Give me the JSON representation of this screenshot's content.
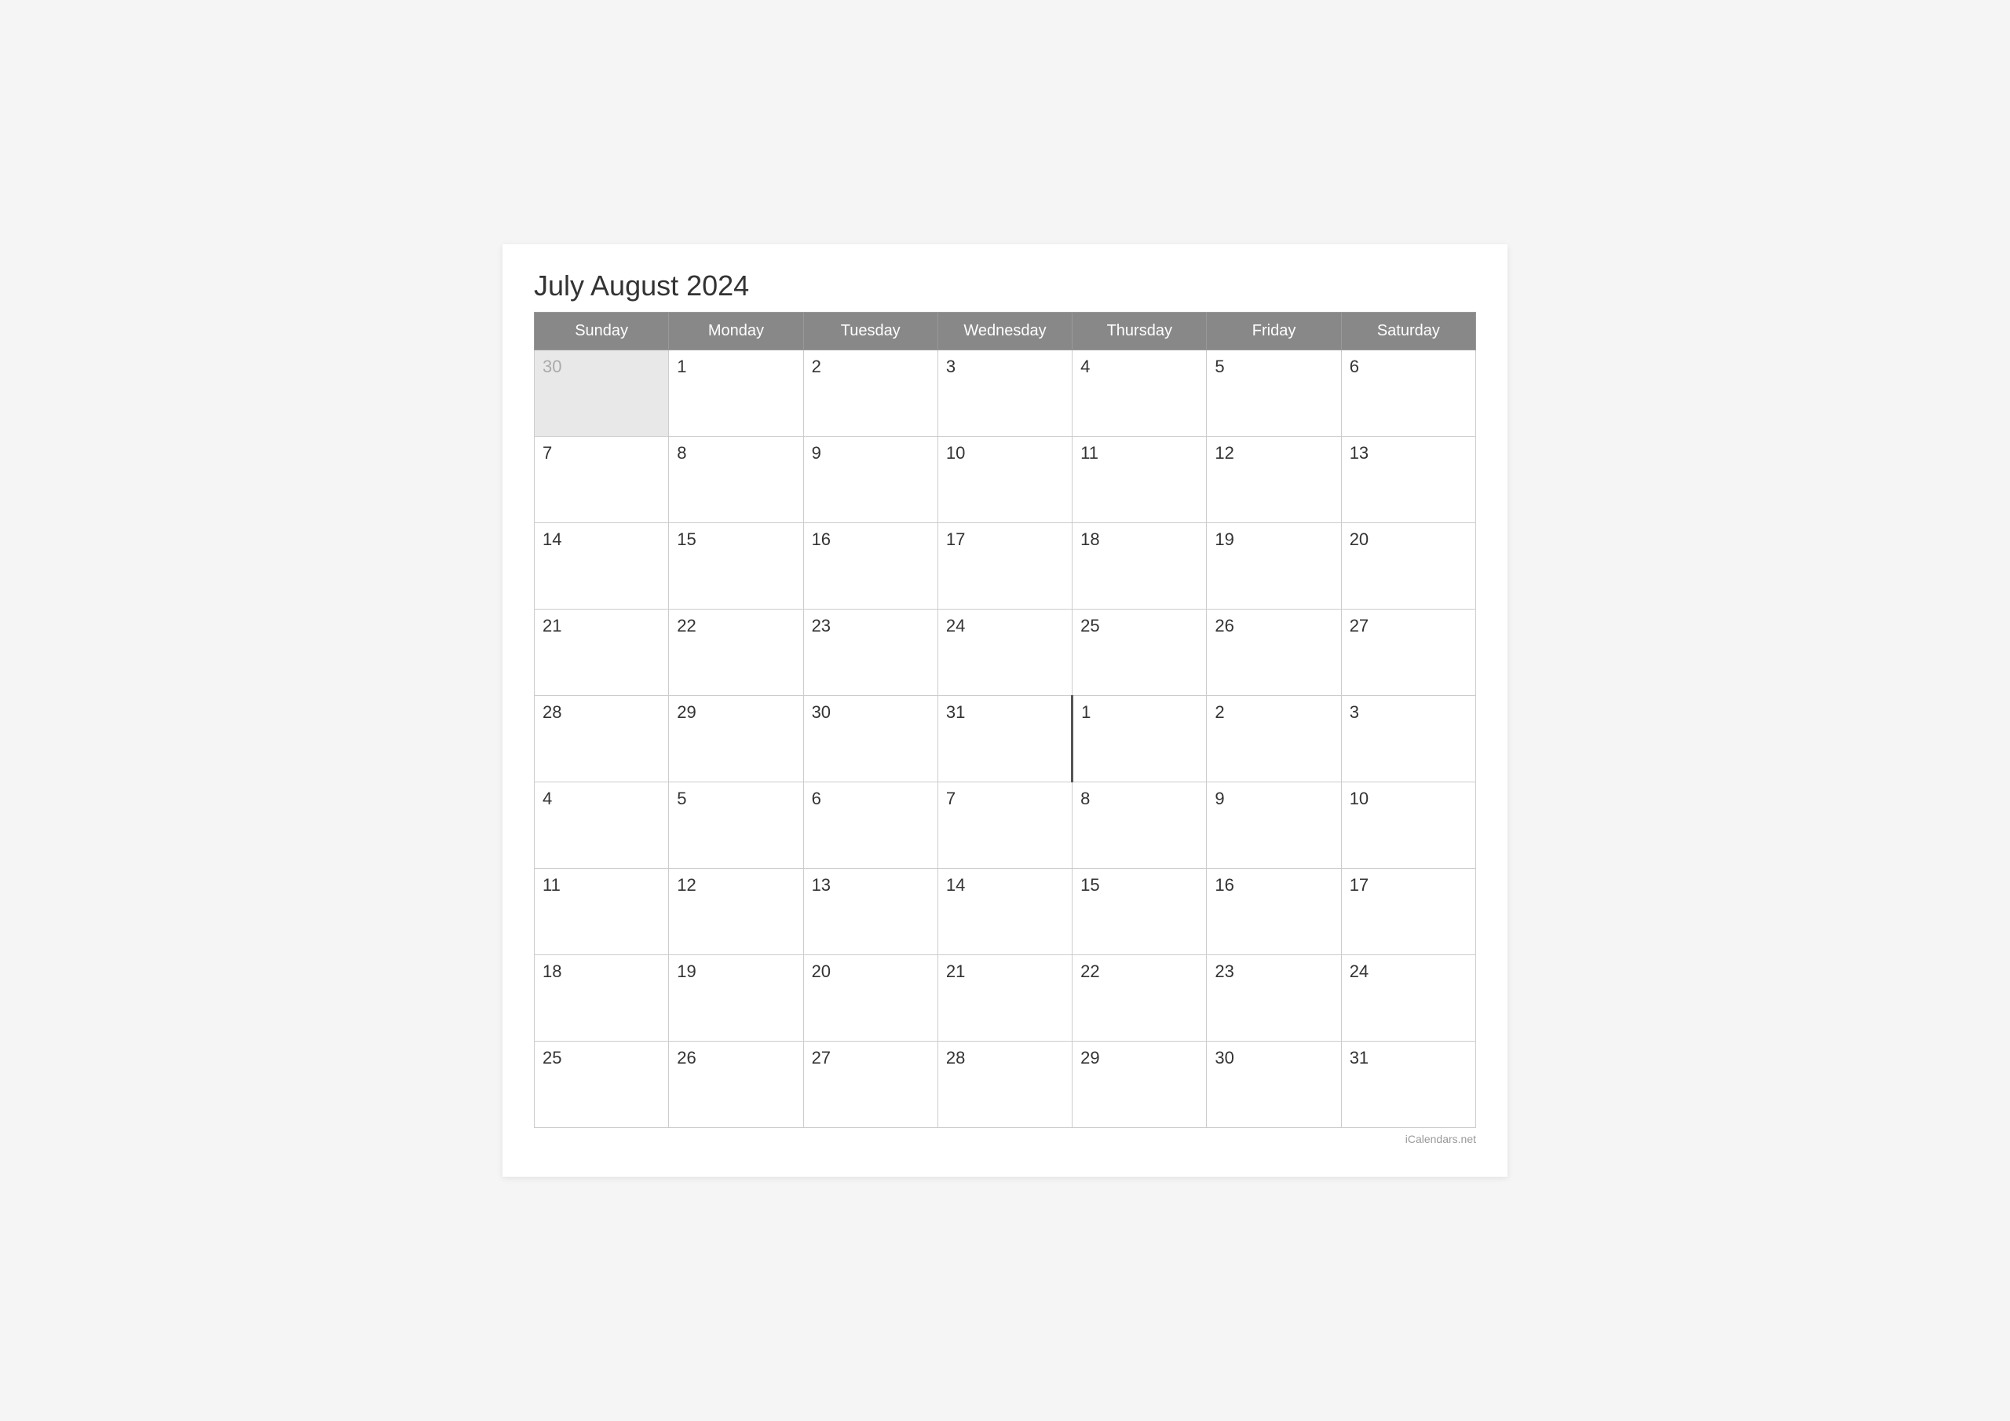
{
  "title": "July August 2024",
  "watermark": "iCalendars.net",
  "headers": [
    "Sunday",
    "Monday",
    "Tuesday",
    "Wednesday",
    "Thursday",
    "Friday",
    "Saturday"
  ],
  "rows": [
    [
      {
        "day": "30",
        "type": "prev-month"
      },
      {
        "day": "1",
        "type": "july"
      },
      {
        "day": "2",
        "type": "july"
      },
      {
        "day": "3",
        "type": "july"
      },
      {
        "day": "4",
        "type": "july"
      },
      {
        "day": "5",
        "type": "july"
      },
      {
        "day": "6",
        "type": "july"
      }
    ],
    [
      {
        "day": "7",
        "type": "july"
      },
      {
        "day": "8",
        "type": "july"
      },
      {
        "day": "9",
        "type": "july"
      },
      {
        "day": "10",
        "type": "july"
      },
      {
        "day": "11",
        "type": "july"
      },
      {
        "day": "12",
        "type": "july"
      },
      {
        "day": "13",
        "type": "july"
      }
    ],
    [
      {
        "day": "14",
        "type": "july"
      },
      {
        "day": "15",
        "type": "july"
      },
      {
        "day": "16",
        "type": "july"
      },
      {
        "day": "17",
        "type": "july"
      },
      {
        "day": "18",
        "type": "july"
      },
      {
        "day": "19",
        "type": "july"
      },
      {
        "day": "20",
        "type": "july"
      }
    ],
    [
      {
        "day": "21",
        "type": "july"
      },
      {
        "day": "22",
        "type": "july"
      },
      {
        "day": "23",
        "type": "july"
      },
      {
        "day": "24",
        "type": "july"
      },
      {
        "day": "25",
        "type": "july"
      },
      {
        "day": "26",
        "type": "july"
      },
      {
        "day": "27",
        "type": "july"
      }
    ],
    [
      {
        "day": "28",
        "type": "july"
      },
      {
        "day": "29",
        "type": "july"
      },
      {
        "day": "30",
        "type": "july"
      },
      {
        "day": "31",
        "type": "july",
        "boundary": "right"
      },
      {
        "day": "1",
        "type": "august"
      },
      {
        "day": "2",
        "type": "august"
      },
      {
        "day": "3",
        "type": "august"
      }
    ],
    [
      {
        "day": "4",
        "type": "august"
      },
      {
        "day": "5",
        "type": "august"
      },
      {
        "day": "6",
        "type": "august"
      },
      {
        "day": "7",
        "type": "august"
      },
      {
        "day": "8",
        "type": "august"
      },
      {
        "day": "9",
        "type": "august"
      },
      {
        "day": "10",
        "type": "august"
      }
    ],
    [
      {
        "day": "11",
        "type": "august"
      },
      {
        "day": "12",
        "type": "august"
      },
      {
        "day": "13",
        "type": "august"
      },
      {
        "day": "14",
        "type": "august"
      },
      {
        "day": "15",
        "type": "august"
      },
      {
        "day": "16",
        "type": "august"
      },
      {
        "day": "17",
        "type": "august"
      }
    ],
    [
      {
        "day": "18",
        "type": "august"
      },
      {
        "day": "19",
        "type": "august"
      },
      {
        "day": "20",
        "type": "august"
      },
      {
        "day": "21",
        "type": "august"
      },
      {
        "day": "22",
        "type": "august"
      },
      {
        "day": "23",
        "type": "august"
      },
      {
        "day": "24",
        "type": "august"
      }
    ],
    [
      {
        "day": "25",
        "type": "august"
      },
      {
        "day": "26",
        "type": "august"
      },
      {
        "day": "27",
        "type": "august"
      },
      {
        "day": "28",
        "type": "august"
      },
      {
        "day": "29",
        "type": "august"
      },
      {
        "day": "30",
        "type": "august"
      },
      {
        "day": "31",
        "type": "august"
      }
    ]
  ]
}
